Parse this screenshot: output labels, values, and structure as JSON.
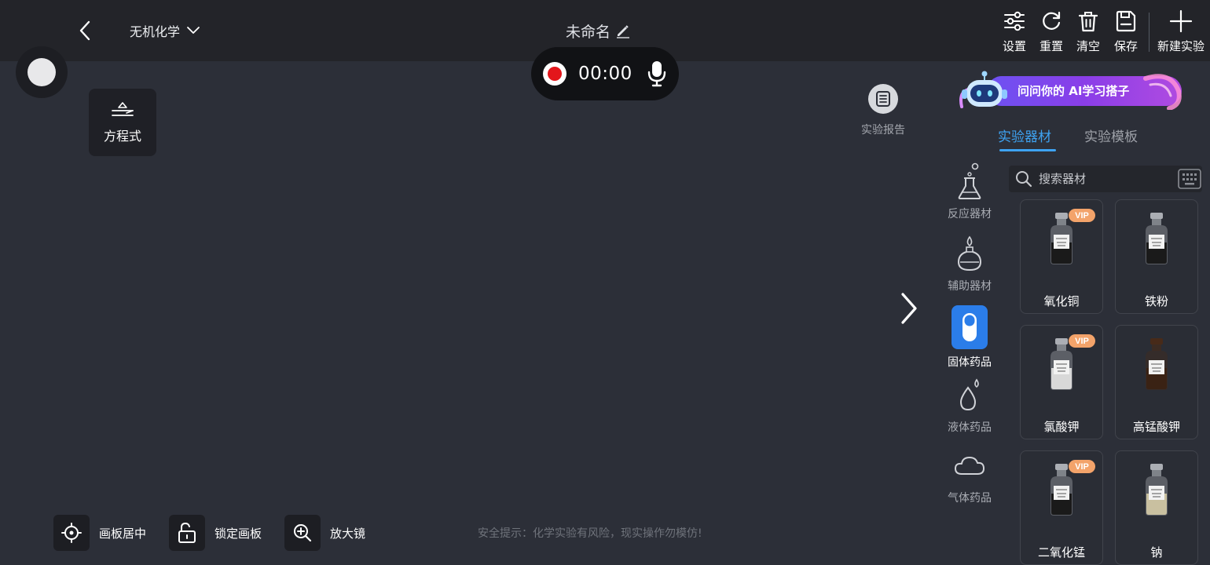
{
  "header": {
    "subject": "无机化学",
    "title": "未命名",
    "actions": [
      {
        "label": "设置",
        "icon": "settings-sliders-icon"
      },
      {
        "label": "重置",
        "icon": "refresh-icon"
      },
      {
        "label": "清空",
        "icon": "trash-icon"
      },
      {
        "label": "保存",
        "icon": "save-icon"
      },
      {
        "label": "新建实验",
        "icon": "plus-icon"
      }
    ]
  },
  "recorder": {
    "time": "00:00"
  },
  "tools": {
    "equation": "方程式",
    "report": "实验报告"
  },
  "ai_banner": {
    "text": "问问你的 AI学习搭子"
  },
  "panel": {
    "tabs": [
      {
        "label": "实验器材",
        "active": true
      },
      {
        "label": "实验模板",
        "active": false
      }
    ],
    "search_placeholder": "搜索器材",
    "categories": [
      {
        "label": "反应器材",
        "icon": "flask-icon",
        "active": false
      },
      {
        "label": "辅助器材",
        "icon": "alcohol-lamp-icon",
        "active": false
      },
      {
        "label": "固体药品",
        "icon": "capsule-icon",
        "active": true
      },
      {
        "label": "液体药品",
        "icon": "droplet-icon",
        "active": false
      },
      {
        "label": "气体药品",
        "icon": "cloud-icon",
        "active": false
      }
    ],
    "items": [
      {
        "label": "氧化铜",
        "vip": "VIP",
        "bottle_color": "#1a1a1a",
        "glass": "clear"
      },
      {
        "label": "铁粉",
        "vip": "",
        "bottle_color": "#1a1a1a",
        "glass": "clear"
      },
      {
        "label": "氯酸钾",
        "vip": "VIP",
        "bottle_color": "#d8d8d8",
        "glass": "clear"
      },
      {
        "label": "高锰酸钾",
        "vip": "",
        "bottle_color": "#3a2214",
        "glass": "brown"
      },
      {
        "label": "二氧化锰",
        "vip": "VIP",
        "bottle_color": "#1a1a1a",
        "glass": "clear"
      },
      {
        "label": "钠",
        "vip": "",
        "bottle_color": "#c9c0a0",
        "glass": "clear"
      }
    ]
  },
  "bottom": {
    "center": "画板居中",
    "lock": "锁定画板",
    "magnifier": "放大镜",
    "safety": "安全提示：化学实验有风险，现实操作勿模仿!"
  },
  "colors": {
    "accent": "#3ea3f2",
    "category_active": "#2b7de9",
    "record_red": "#e3161b",
    "vip": "#f3a36a"
  }
}
